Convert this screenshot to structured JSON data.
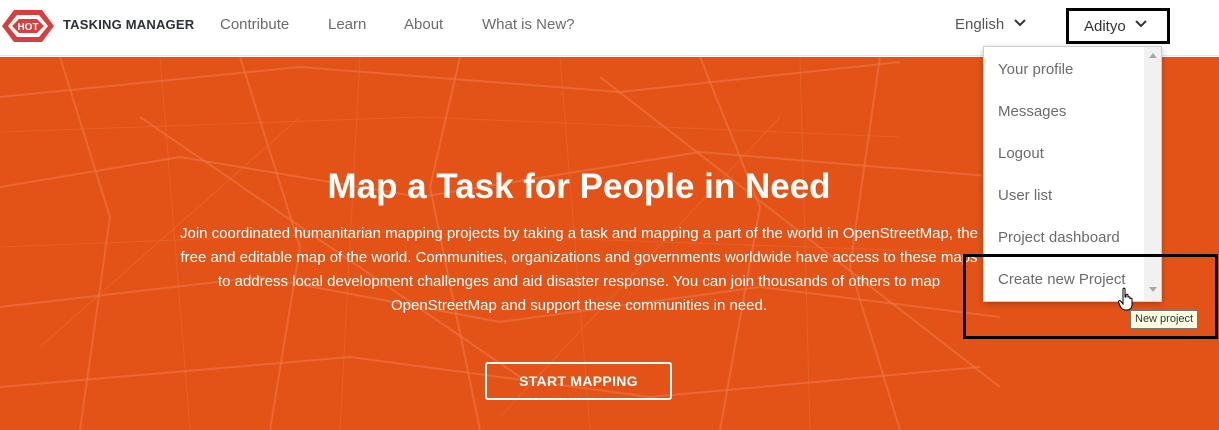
{
  "header": {
    "logo_text": "HOT",
    "brand": "TASKING MANAGER",
    "nav": [
      {
        "label": "Contribute"
      },
      {
        "label": "Learn"
      },
      {
        "label": "About"
      },
      {
        "label": "What is New?"
      }
    ],
    "language": "English",
    "user": "Adityo"
  },
  "hero": {
    "title": "Map a Task for People in Need",
    "text": "Join coordinated humanitarian mapping projects by taking a task and mapping a part of the world in OpenStreetMap, the free and editable map of the world. Communities, organizations and governments worldwide have access to these maps to address local development challenges and aid disaster response. You can join thousands of others to map OpenStreetMap and support these communities in need.",
    "cta": "START MAPPING"
  },
  "user_menu": {
    "items": [
      {
        "label": "Your profile"
      },
      {
        "label": "Messages"
      },
      {
        "label": "Logout"
      },
      {
        "label": "User list"
      },
      {
        "label": "Project dashboard"
      },
      {
        "label": "Create new Project"
      }
    ],
    "tooltip": "New project"
  },
  "colors": {
    "hero_bg": "#e35318",
    "brand_red": "#d73f3f",
    "nav_text": "#6b6b6b"
  }
}
